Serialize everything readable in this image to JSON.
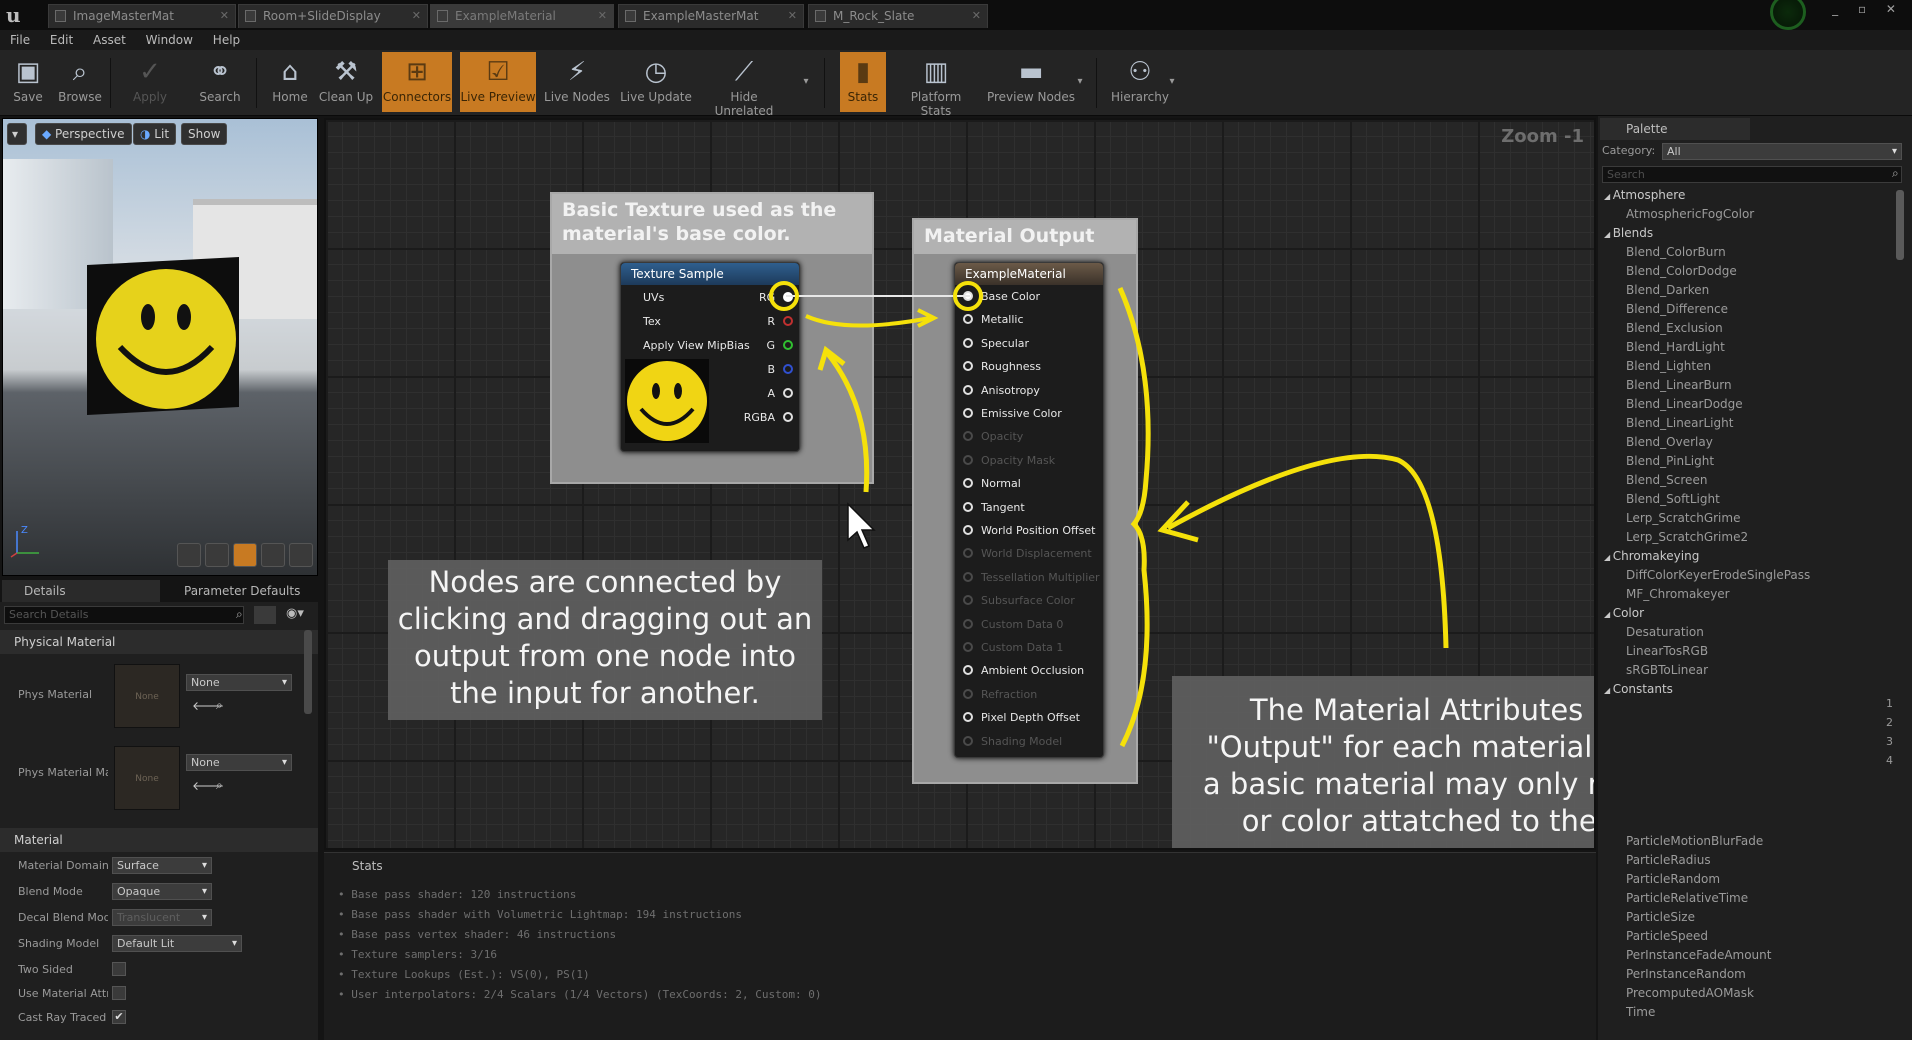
{
  "tabs": [
    "ImageMasterMat",
    "Room+SlideDisplay",
    "ExampleMaterial",
    "ExampleMasterMat",
    "M_Rock_Slate"
  ],
  "menu": [
    "File",
    "Edit",
    "Asset",
    "Window",
    "Help"
  ],
  "toolbar": {
    "save": "Save",
    "browse": "Browse",
    "apply": "Apply",
    "search": "Search",
    "home": "Home",
    "cleanup": "Clean Up",
    "connectors": "Connectors",
    "livepreview": "Live Preview",
    "livenodes": "Live Nodes",
    "liveupdate": "Live Update",
    "hideunrelated": "Hide Unrelated",
    "stats": "Stats",
    "platformstats": "Platform Stats",
    "previewnodes": "Preview Nodes",
    "hierarchy": "Hierarchy"
  },
  "viewport": {
    "perspective": "Perspective",
    "lit": "Lit",
    "show": "Show"
  },
  "details": {
    "tab1": "Details",
    "tab2": "Parameter Defaults",
    "search_placeholder": "Search Details",
    "section_physical": "Physical Material",
    "phys_material": "Phys Material",
    "phys_material_mask": "Phys Material Ma",
    "none": "None",
    "section_material": "Material",
    "props": [
      {
        "label": "Material Domain",
        "value": "Surface"
      },
      {
        "label": "Blend Mode",
        "value": "Opaque"
      },
      {
        "label": "Decal Blend Mode",
        "value": "Translucent"
      },
      {
        "label": "Shading Model",
        "value": "Default Lit"
      },
      {
        "label": "Two Sided",
        "value": ""
      },
      {
        "label": "Use Material Attri",
        "value": ""
      },
      {
        "label": "Cast Ray Traced",
        "value": "✔"
      }
    ]
  },
  "graph": {
    "zoom": "Zoom -1",
    "comment1": "Basic Texture used as the material's base color.",
    "comment2": "Material Output",
    "texture_node": {
      "title": "Texture Sample",
      "inputs": [
        "UVs",
        "Tex",
        "Apply View MipBias"
      ],
      "outputs": [
        "RGB",
        "R",
        "G",
        "B",
        "A",
        "RGBA"
      ]
    },
    "output_node": {
      "title": "ExampleMaterial",
      "pins": [
        {
          "label": "Base Color",
          "active": true
        },
        {
          "label": "Metallic",
          "active": true
        },
        {
          "label": "Specular",
          "active": true
        },
        {
          "label": "Roughness",
          "active": true
        },
        {
          "label": "Anisotropy",
          "active": true
        },
        {
          "label": "Emissive Color",
          "active": true
        },
        {
          "label": "Opacity",
          "active": false
        },
        {
          "label": "Opacity Mask",
          "active": false
        },
        {
          "label": "Normal",
          "active": true
        },
        {
          "label": "Tangent",
          "active": true
        },
        {
          "label": "World Position Offset",
          "active": true
        },
        {
          "label": "World Displacement",
          "active": false
        },
        {
          "label": "Tessellation Multiplier",
          "active": false
        },
        {
          "label": "Subsurface Color",
          "active": false
        },
        {
          "label": "Custom Data 0",
          "active": false
        },
        {
          "label": "Custom Data 1",
          "active": false
        },
        {
          "label": "Ambient Occlusion",
          "active": true
        },
        {
          "label": "Refraction",
          "active": false
        },
        {
          "label": "Pixel Depth Offset",
          "active": true
        },
        {
          "label": "Shading Model",
          "active": false
        }
      ]
    },
    "note_left": "Nodes are connected by clicking and dragging out an output from one node into the input for another.",
    "note_right": "The Material Attributes node is the \"Output\" for each material. At minimum, a basic material may only need a texture or color attatched to the base color.",
    "annotation_color": "#f5e10a"
  },
  "stats": {
    "tab": "Stats",
    "lines": [
      "Base pass shader: 120 instructions",
      "Base pass shader with Volumetric Lightmap: 194 instructions",
      "Base pass vertex shader: 46 instructions",
      "Texture samplers: 3/16",
      "Texture Lookups (Est.): VS(0), PS(1)",
      "User interpolators: 2/4 Scalars (1/4 Vectors) (TexCoords: 2, Custom: 0)"
    ]
  },
  "palette": {
    "tab": "Palette",
    "category_label": "Category:",
    "category_value": "All",
    "search_placeholder": "Search",
    "items": [
      {
        "t": "Atmosphere",
        "c": true
      },
      {
        "t": "AtmosphericFogColor"
      },
      {
        "t": "Blends",
        "c": true
      },
      {
        "t": "Blend_ColorBurn"
      },
      {
        "t": "Blend_ColorDodge"
      },
      {
        "t": "Blend_Darken"
      },
      {
        "t": "Blend_Difference"
      },
      {
        "t": "Blend_Exclusion"
      },
      {
        "t": "Blend_HardLight"
      },
      {
        "t": "Blend_Lighten"
      },
      {
        "t": "Blend_LinearBurn"
      },
      {
        "t": "Blend_LinearDodge"
      },
      {
        "t": "Blend_LinearLight"
      },
      {
        "t": "Blend_Overlay"
      },
      {
        "t": "Blend_PinLight"
      },
      {
        "t": "Blend_Screen"
      },
      {
        "t": "Blend_SoftLight"
      },
      {
        "t": "Lerp_ScratchGrime"
      },
      {
        "t": "Lerp_ScratchGrime2"
      },
      {
        "t": "Chromakeying",
        "c": true
      },
      {
        "t": "DiffColorKeyerErodeSinglePass"
      },
      {
        "t": "MF_Chromakeyer"
      },
      {
        "t": "Color",
        "c": true
      },
      {
        "t": "Desaturation"
      },
      {
        "t": "LinearTosRGB"
      },
      {
        "t": "sRGBToLinear"
      },
      {
        "t": "Constants",
        "c": true
      },
      {
        "t": ""
      },
      {
        "t": ""
      },
      {
        "t": ""
      },
      {
        "t": ""
      },
      {
        "t": ""
      },
      {
        "t": ""
      },
      {
        "t": ""
      },
      {
        "t": "ParticleMotionBlurFade"
      },
      {
        "t": "ParticleRadius"
      },
      {
        "t": "ParticleRandom"
      },
      {
        "t": "ParticleRelativeTime"
      },
      {
        "t": "ParticleSize"
      },
      {
        "t": "ParticleSpeed"
      },
      {
        "t": "PerInstanceFadeAmount"
      },
      {
        "t": "PerInstanceRandom"
      },
      {
        "t": "PrecomputedAOMask"
      },
      {
        "t": "Time"
      }
    ],
    "nums": [
      "1",
      "2",
      "3",
      "4"
    ]
  }
}
